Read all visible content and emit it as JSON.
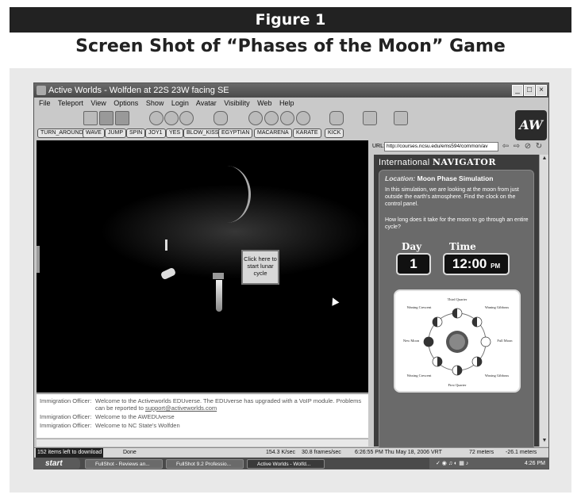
{
  "figure": {
    "label": "Figure 1",
    "title": "Screen Shot of “Phases of the Moon” Game"
  },
  "window": {
    "title": "Active Worlds - Wolfden at 22S 23W facing SE",
    "buttons": [
      "_",
      "□",
      "×"
    ]
  },
  "menu": [
    "File",
    "Teleport",
    "View",
    "Options",
    "Show",
    "Login",
    "Avatar",
    "Visibility",
    "Web",
    "Help"
  ],
  "gestures": [
    "TURN_AROUND",
    "WAVE",
    "JUMP",
    "SPIN",
    "JOY1",
    "YES",
    "BLOW_KISS",
    "EGYPTIAN",
    "MACARENA",
    "KARATE",
    "KICK"
  ],
  "logo_text": "AW",
  "scene": {
    "lunar_button": "Click here to start lunar cycle"
  },
  "chat": [
    {
      "who": "Immigration Officer:",
      "msg": "Welcome to the Activeworlds EDUverse. The EDUverse has upgraded with a VoIP module.  Problems can be reported to",
      "link": "support@activeworlds.com"
    },
    {
      "who": "Immigration Officer:",
      "msg": "Welcome to the AWEDUverse",
      "link": ""
    },
    {
      "who": "Immigration Officer:",
      "msg": "Welcome to NC State's Wolfden",
      "link": ""
    }
  ],
  "browser": {
    "url_label": "URL:",
    "url": "http://courses.ncsu.edu/ems594/common/av",
    "nav_title_prefix": "International",
    "nav_title_main": "NAVIGATOR",
    "location_label": "Location:",
    "location_value": "Moon Phase Simulation",
    "intro": "In this simulation, we are looking at the moon from just outside the earth's atmosphere. Find the clock on the control panel.",
    "question": "How long does it take for the moon to go through an entire cycle?",
    "day_label": "Day",
    "time_label": "Time",
    "day_value": "1",
    "time_value": "12:00",
    "time_suffix": "PM",
    "diagram_labels": {
      "top": "Third Quarter",
      "top_left": "Waning Crescent",
      "top_right": "Waning Gibbous",
      "left": "New Moon",
      "right": "Full Moon",
      "bottom_left": "Waxing Crescent",
      "bottom_right": "Waxing Gibbous",
      "bottom": "First Quarter"
    }
  },
  "status": {
    "downloads": "152 items left to download",
    "done": "Done",
    "rate": "154.3 K/sec",
    "fps": "30.8 frames/sec",
    "datetime": "6:26:55 PM Thu May 18, 2006 VRT",
    "distance": "72 meters",
    "altitude": "-26.1 meters"
  },
  "taskbar": {
    "start": "start",
    "tasks": [
      "FullShot - Reviews an...",
      "FullShot 9.2 Professio...",
      "Active Worlds - Wolfd..."
    ],
    "clock": "4:26 PM"
  }
}
